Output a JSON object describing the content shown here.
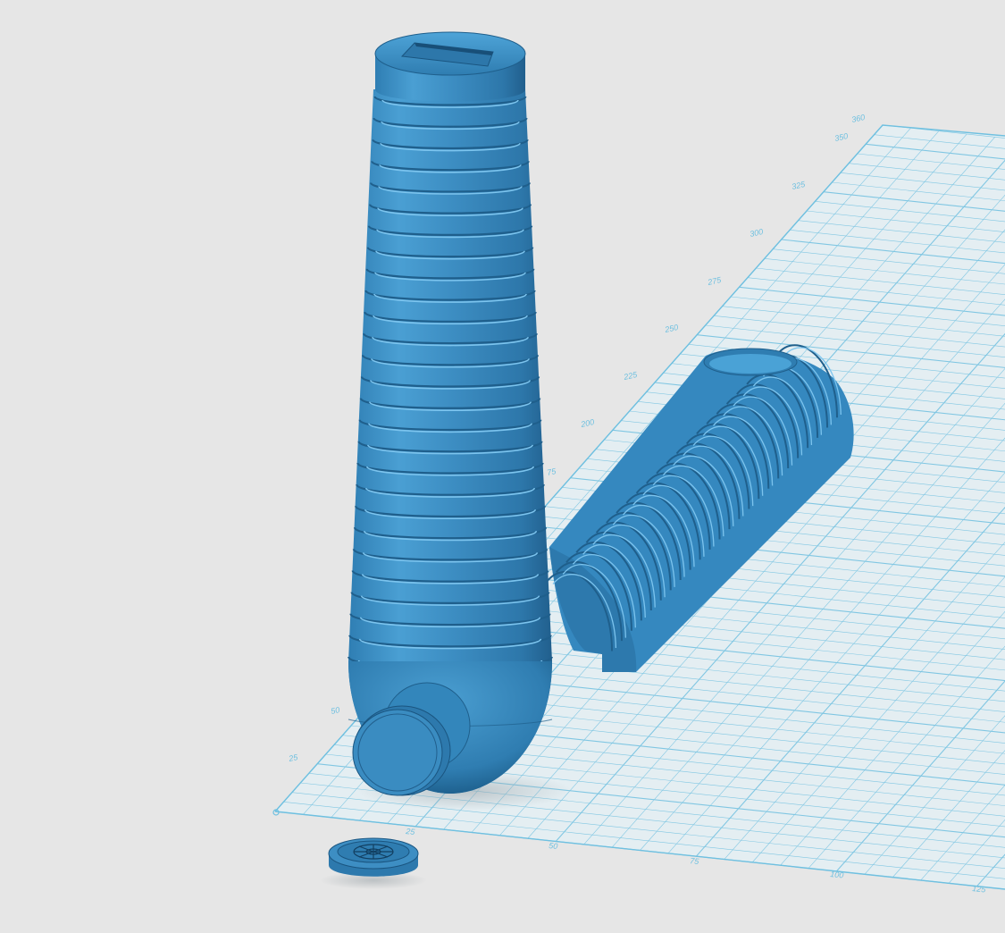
{
  "scene": {
    "background": "#e6e6e6",
    "grid_color": "#6fc0e0",
    "plate_color": "#e4eef2",
    "model_color": "#3d8ec3",
    "model_highlight": "#7cc4ee",
    "model_shadow": "#1f5f8c",
    "objects": [
      {
        "name": "hilt-vertical",
        "kind": "ridged-tapered-grip",
        "orientation": "standing"
      },
      {
        "name": "hilt-half-lying",
        "kind": "ridged-half-shell",
        "orientation": "lying"
      },
      {
        "name": "pommel-cap",
        "kind": "round-cap"
      },
      {
        "name": "emblem-disc",
        "kind": "emblem-coin",
        "icon": "imperial-crest-icon"
      }
    ]
  },
  "axes": {
    "y_ticks": [
      "25",
      "50",
      "75",
      "200",
      "225",
      "250",
      "275",
      "300",
      "325",
      "350",
      "360"
    ],
    "x_ticks": [
      "25",
      "50",
      "75",
      "100",
      "125"
    ]
  }
}
